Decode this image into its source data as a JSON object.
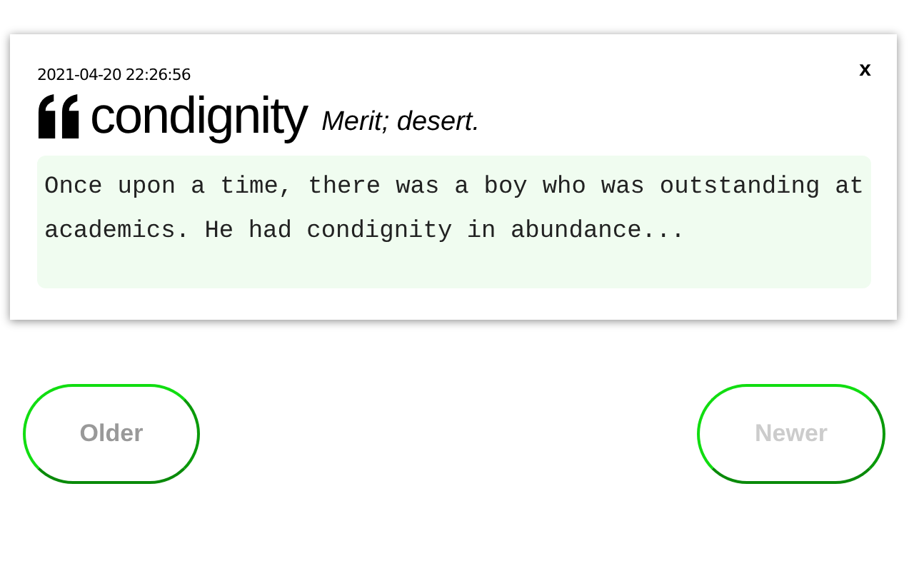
{
  "card": {
    "close": "x",
    "timestamp": "2021-04-20 22:26:56",
    "word": "condignity",
    "definition": "Merit; desert.",
    "story": "Once upon a time, there was a boy who was outstanding at academics. He had condignity in abundance..."
  },
  "buttons": [
    {
      "label": "Older",
      "disabled": false
    },
    {
      "label": "Newer",
      "disabled": true
    }
  ]
}
